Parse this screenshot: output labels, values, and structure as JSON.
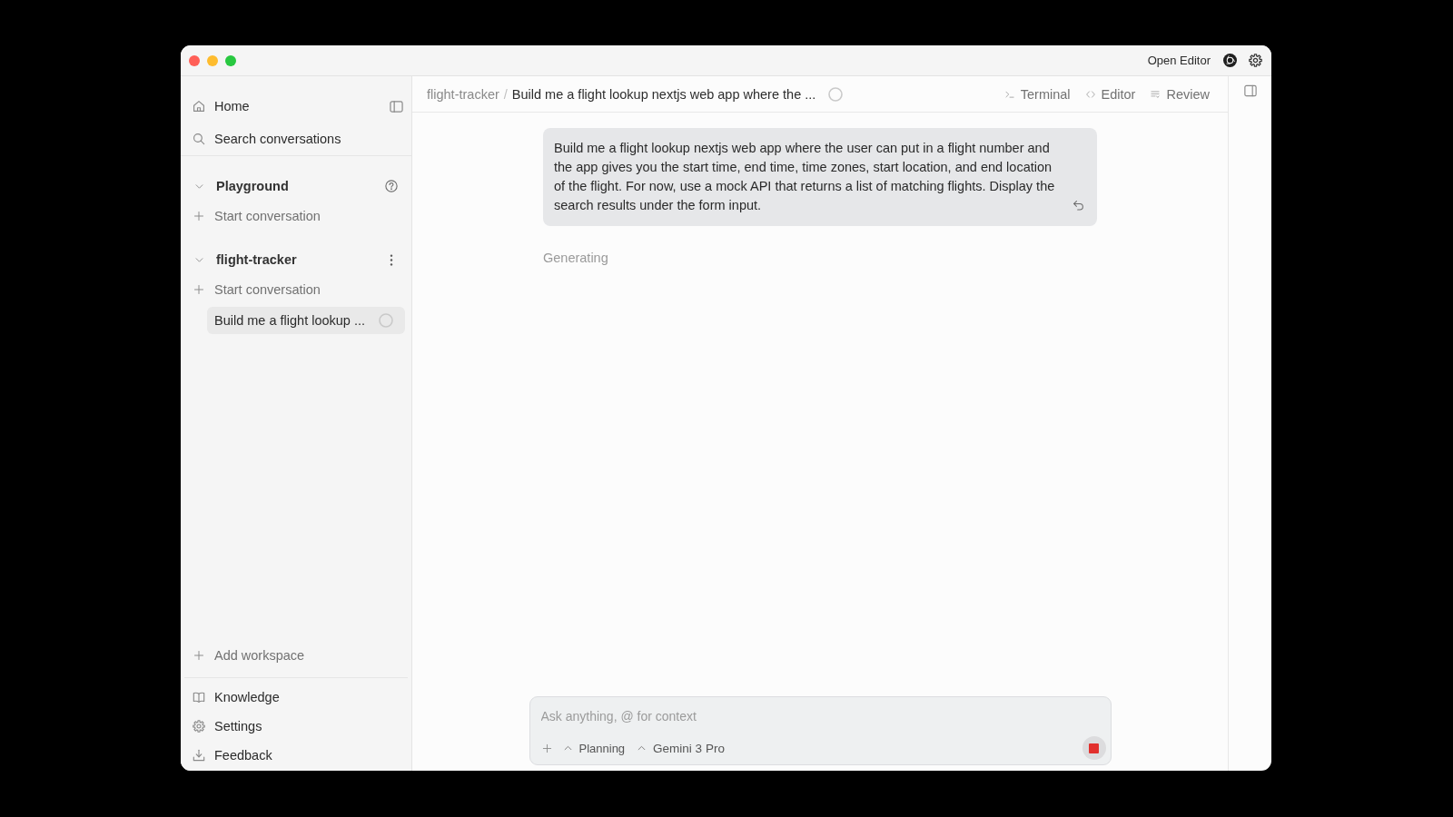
{
  "title_bar": {
    "action": "Open Editor"
  },
  "sidebar": {
    "nav": [
      {
        "kind": "home",
        "label": "Home"
      },
      {
        "kind": "search",
        "label": "Search conversations"
      }
    ],
    "workspaces": [
      {
        "name": "Playground",
        "expanded": true,
        "menu": {
          "kind": "help"
        },
        "start": "Start conversation"
      },
      {
        "name": "flight-tracker",
        "expanded": true,
        "menu": {
          "kind": "more"
        },
        "start": "Start conversation",
        "conversations": [
          {
            "title": "Build me a flight lookup ...",
            "selected": true,
            "loading": true
          }
        ]
      }
    ],
    "add_workspace": "Add workspace",
    "footer": [
      {
        "kind": "knowledge",
        "label": "Knowledge"
      },
      {
        "kind": "settings",
        "label": "Settings"
      },
      {
        "kind": "feedback",
        "label": "Feedback"
      }
    ]
  },
  "header": {
    "breadcrumb": {
      "parent": "flight-tracker",
      "separator": "/",
      "current": "Build me a flight lookup nextjs web app where the ...",
      "loading": true
    },
    "tools": [
      {
        "kind": "terminal",
        "label": "Terminal"
      },
      {
        "kind": "editor",
        "label": "Editor"
      },
      {
        "kind": "review",
        "label": "Review"
      }
    ]
  },
  "chat": {
    "messages": [
      {
        "kind": "user",
        "text": "Build me a flight lookup nextjs web app where the user can put in a flight number and the app gives you the start time, end time, time zones, start location, and end location of the flight. For now, use a mock API that returns a list of matching flights. Display the search results under the form input."
      }
    ],
    "status": "Generating"
  },
  "composer": {
    "placeholder": "Ask anything, @ for context",
    "mode": "Planning",
    "model": "Gemini 3 Pro",
    "running": true
  }
}
